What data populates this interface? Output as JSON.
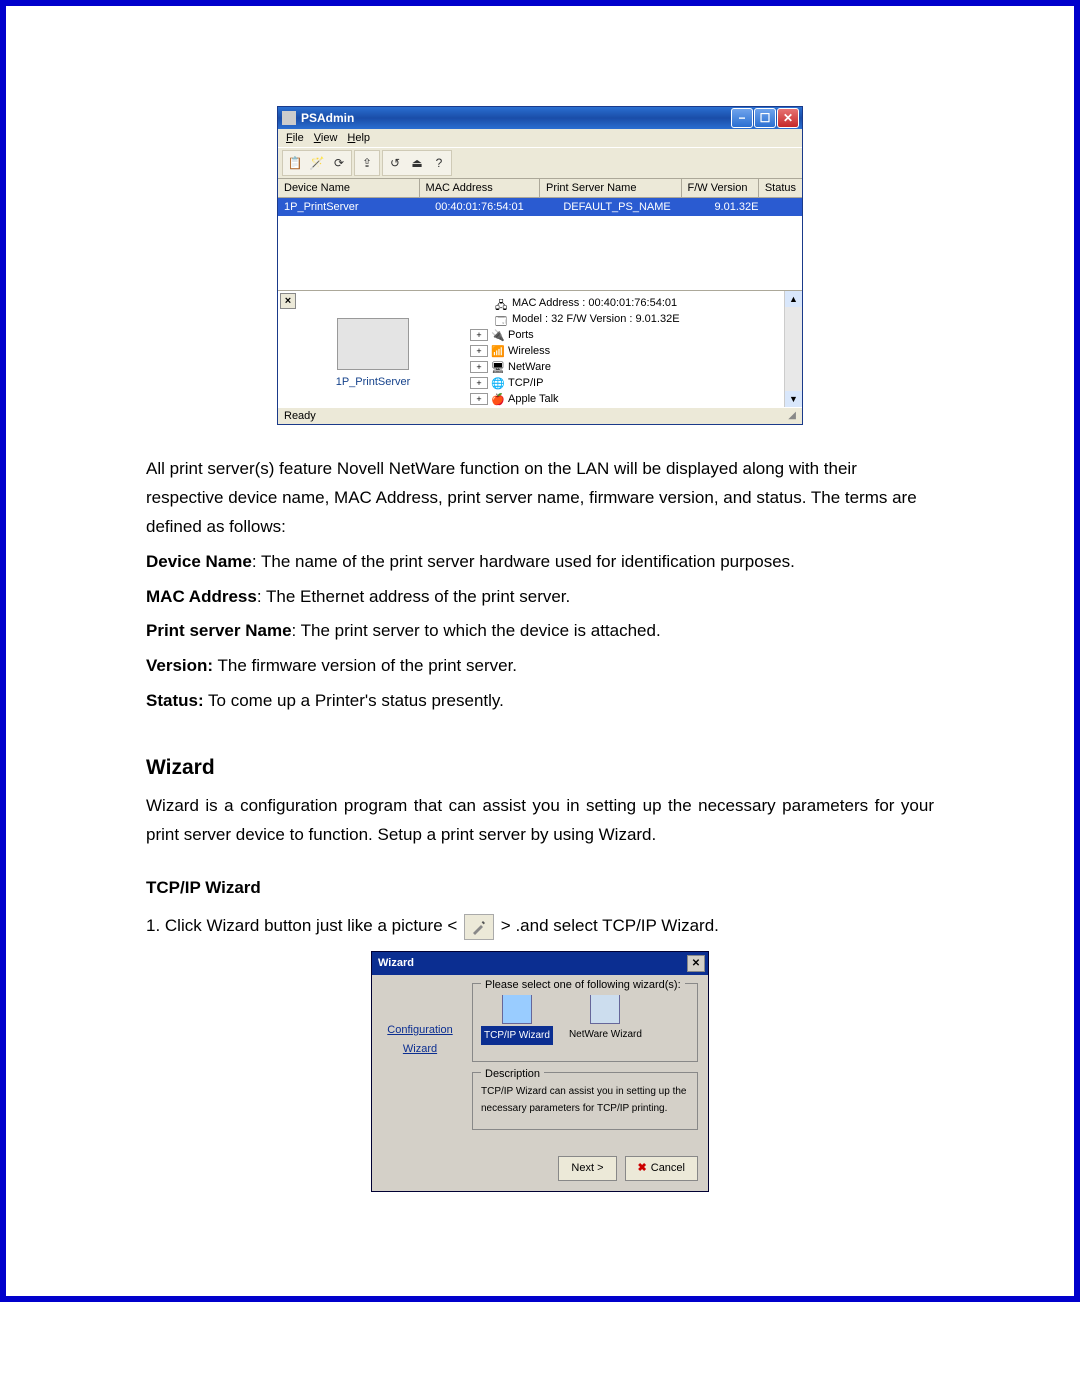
{
  "psadmin": {
    "title": "PSAdmin",
    "menubar": [
      "File",
      "View",
      "Help"
    ],
    "columns": [
      "Device Name",
      "MAC Address",
      "Print Server Name",
      "F/W Version",
      "Status"
    ],
    "row": {
      "device_name": "1P_PrintServer",
      "mac": "00:40:01:76:54:01",
      "ps_name": "DEFAULT_PS_NAME",
      "fw": "9.01.32E",
      "status": ""
    },
    "detail_caption": "1P_PrintServer",
    "tree": {
      "mac": "MAC Address : 00:40:01:76:54:01",
      "model": "Model : 32  F/W Version : 9.01.32E",
      "nodes": [
        "Ports",
        "Wireless",
        "NetWare",
        "TCP/IP",
        "Apple Talk"
      ]
    },
    "statusbar": "Ready"
  },
  "doc": {
    "p1": "All print server(s) feature Novell NetWare function on the LAN will be displayed along with their respective device name, MAC Address, print server name, firmware version, and status. The terms are defined as follows:",
    "def_device_label": "Device Name",
    "def_device_text": ": The name of the print server hardware used for identification purposes.",
    "def_mac_label": "MAC Address",
    "def_mac_text": ": The Ethernet address of the print server.",
    "def_psname_label": "Print server Name",
    "def_psname_text": ": The print server to which the device is attached.",
    "def_version_label": "Version:",
    "def_version_text": " The firmware version of the print server.",
    "def_status_label": "Status:",
    "def_status_text": " To come up a Printer's status presently.",
    "h_wizard": "Wizard",
    "p_wizard": "Wizard is a configuration program that can assist you in setting up the necessary parameters for your print server device to function. Setup a print server by using Wizard.",
    "h_tcpip": "TCP/IP Wizard",
    "step1_pre": "1. Click Wizard button just like a picture <",
    "step1_post": " > .and select TCP/IP Wizard."
  },
  "wizard_dialog": {
    "title": "Wizard",
    "left_link": "Configuration Wizard",
    "group1_legend": "Please select one of following wizard(s):",
    "icon_tcpip": "TCP/IP Wizard",
    "icon_netware": "NetWare Wizard",
    "group2_legend": "Description",
    "desc_text": "TCP/IP Wizard can assist you in setting up the necessary parameters for TCP/IP printing.",
    "btn_next": "Next  >",
    "btn_cancel": "Cancel"
  }
}
